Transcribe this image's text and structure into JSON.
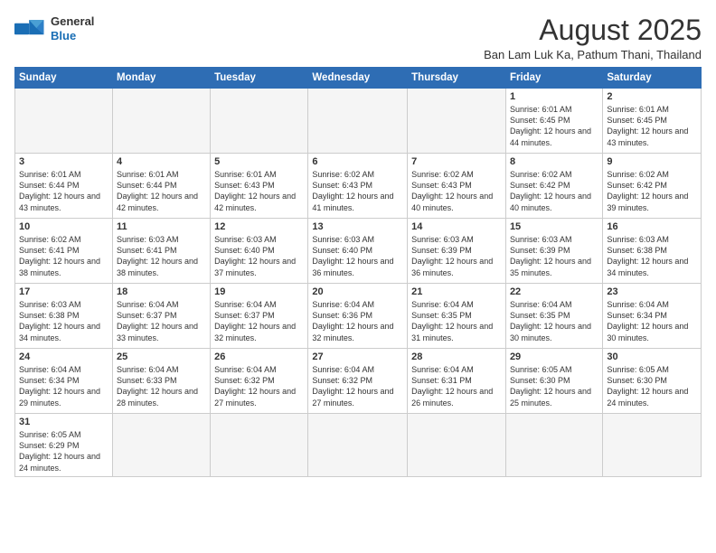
{
  "logo": {
    "line1": "General",
    "line2": "Blue"
  },
  "title": "August 2025",
  "location": "Ban Lam Luk Ka, Pathum Thani, Thailand",
  "days_of_week": [
    "Sunday",
    "Monday",
    "Tuesday",
    "Wednesday",
    "Thursday",
    "Friday",
    "Saturday"
  ],
  "weeks": [
    [
      {
        "day": "",
        "info": ""
      },
      {
        "day": "",
        "info": ""
      },
      {
        "day": "",
        "info": ""
      },
      {
        "day": "",
        "info": ""
      },
      {
        "day": "",
        "info": ""
      },
      {
        "day": "1",
        "info": "Sunrise: 6:01 AM\nSunset: 6:45 PM\nDaylight: 12 hours\nand 44 minutes."
      },
      {
        "day": "2",
        "info": "Sunrise: 6:01 AM\nSunset: 6:45 PM\nDaylight: 12 hours\nand 43 minutes."
      }
    ],
    [
      {
        "day": "3",
        "info": "Sunrise: 6:01 AM\nSunset: 6:44 PM\nDaylight: 12 hours\nand 43 minutes."
      },
      {
        "day": "4",
        "info": "Sunrise: 6:01 AM\nSunset: 6:44 PM\nDaylight: 12 hours\nand 42 minutes."
      },
      {
        "day": "5",
        "info": "Sunrise: 6:01 AM\nSunset: 6:43 PM\nDaylight: 12 hours\nand 42 minutes."
      },
      {
        "day": "6",
        "info": "Sunrise: 6:02 AM\nSunset: 6:43 PM\nDaylight: 12 hours\nand 41 minutes."
      },
      {
        "day": "7",
        "info": "Sunrise: 6:02 AM\nSunset: 6:43 PM\nDaylight: 12 hours\nand 40 minutes."
      },
      {
        "day": "8",
        "info": "Sunrise: 6:02 AM\nSunset: 6:42 PM\nDaylight: 12 hours\nand 40 minutes."
      },
      {
        "day": "9",
        "info": "Sunrise: 6:02 AM\nSunset: 6:42 PM\nDaylight: 12 hours\nand 39 minutes."
      }
    ],
    [
      {
        "day": "10",
        "info": "Sunrise: 6:02 AM\nSunset: 6:41 PM\nDaylight: 12 hours\nand 38 minutes."
      },
      {
        "day": "11",
        "info": "Sunrise: 6:03 AM\nSunset: 6:41 PM\nDaylight: 12 hours\nand 38 minutes."
      },
      {
        "day": "12",
        "info": "Sunrise: 6:03 AM\nSunset: 6:40 PM\nDaylight: 12 hours\nand 37 minutes."
      },
      {
        "day": "13",
        "info": "Sunrise: 6:03 AM\nSunset: 6:40 PM\nDaylight: 12 hours\nand 36 minutes."
      },
      {
        "day": "14",
        "info": "Sunrise: 6:03 AM\nSunset: 6:39 PM\nDaylight: 12 hours\nand 36 minutes."
      },
      {
        "day": "15",
        "info": "Sunrise: 6:03 AM\nSunset: 6:39 PM\nDaylight: 12 hours\nand 35 minutes."
      },
      {
        "day": "16",
        "info": "Sunrise: 6:03 AM\nSunset: 6:38 PM\nDaylight: 12 hours\nand 34 minutes."
      }
    ],
    [
      {
        "day": "17",
        "info": "Sunrise: 6:03 AM\nSunset: 6:38 PM\nDaylight: 12 hours\nand 34 minutes."
      },
      {
        "day": "18",
        "info": "Sunrise: 6:04 AM\nSunset: 6:37 PM\nDaylight: 12 hours\nand 33 minutes."
      },
      {
        "day": "19",
        "info": "Sunrise: 6:04 AM\nSunset: 6:37 PM\nDaylight: 12 hours\nand 32 minutes."
      },
      {
        "day": "20",
        "info": "Sunrise: 6:04 AM\nSunset: 6:36 PM\nDaylight: 12 hours\nand 32 minutes."
      },
      {
        "day": "21",
        "info": "Sunrise: 6:04 AM\nSunset: 6:35 PM\nDaylight: 12 hours\nand 31 minutes."
      },
      {
        "day": "22",
        "info": "Sunrise: 6:04 AM\nSunset: 6:35 PM\nDaylight: 12 hours\nand 30 minutes."
      },
      {
        "day": "23",
        "info": "Sunrise: 6:04 AM\nSunset: 6:34 PM\nDaylight: 12 hours\nand 30 minutes."
      }
    ],
    [
      {
        "day": "24",
        "info": "Sunrise: 6:04 AM\nSunset: 6:34 PM\nDaylight: 12 hours\nand 29 minutes."
      },
      {
        "day": "25",
        "info": "Sunrise: 6:04 AM\nSunset: 6:33 PM\nDaylight: 12 hours\nand 28 minutes."
      },
      {
        "day": "26",
        "info": "Sunrise: 6:04 AM\nSunset: 6:32 PM\nDaylight: 12 hours\nand 27 minutes."
      },
      {
        "day": "27",
        "info": "Sunrise: 6:04 AM\nSunset: 6:32 PM\nDaylight: 12 hours\nand 27 minutes."
      },
      {
        "day": "28",
        "info": "Sunrise: 6:04 AM\nSunset: 6:31 PM\nDaylight: 12 hours\nand 26 minutes."
      },
      {
        "day": "29",
        "info": "Sunrise: 6:05 AM\nSunset: 6:30 PM\nDaylight: 12 hours\nand 25 minutes."
      },
      {
        "day": "30",
        "info": "Sunrise: 6:05 AM\nSunset: 6:30 PM\nDaylight: 12 hours\nand 24 minutes."
      }
    ],
    [
      {
        "day": "31",
        "info": "Sunrise: 6:05 AM\nSunset: 6:29 PM\nDaylight: 12 hours\nand 24 minutes."
      },
      {
        "day": "",
        "info": ""
      },
      {
        "day": "",
        "info": ""
      },
      {
        "day": "",
        "info": ""
      },
      {
        "day": "",
        "info": ""
      },
      {
        "day": "",
        "info": ""
      },
      {
        "day": "",
        "info": ""
      }
    ]
  ]
}
